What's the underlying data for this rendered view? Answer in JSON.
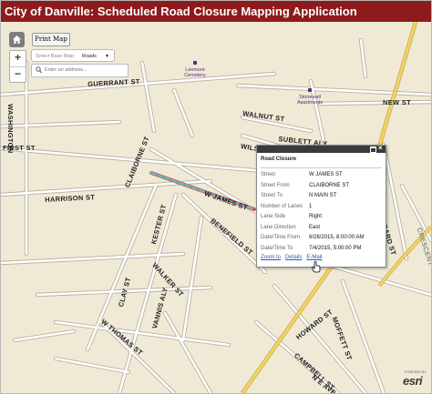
{
  "app": {
    "title": "City of Danville: Scheduled Road Closure Mapping Application"
  },
  "toolbar": {
    "print_label": "Print Map",
    "basemap_label": "Select Base Map:",
    "basemap_value": "Roads",
    "search_placeholder": "Enter an address..."
  },
  "map": {
    "streets": {
      "washington": "WASHINGTON",
      "guerrant": "GUERRANT ST",
      "new": "NEW ST",
      "walnut": "WALNUT ST",
      "sublett": "SUBLETT ALY",
      "wilson": "WILSON",
      "first": "FIRST ST",
      "claiborne": "CLAIBORNE ST",
      "wjames": "W JAMES ST",
      "harrison": "HARRISON ST",
      "kester": "KESTER ST",
      "benefield": "BENEFIELD ST",
      "girard": "GIRARD ST",
      "crescent": "CRESCENT",
      "walker": "WALKER ST",
      "clay": "CLAY ST",
      "wthomas": "W THOMAS ST",
      "vannis": "VANNIS ALY",
      "moffett": "MOFFETT ST",
      "howard": "HOWARD ST",
      "campbell": "CAMPBELL ST",
      "neave": "N E AVE"
    },
    "poi": {
      "cemetery": "Leemont Cemetery",
      "apartments": "Stonewall Apartments"
    }
  },
  "popup": {
    "title": "Road Closure",
    "fields": [
      {
        "key": "Street",
        "value": "W JAMES ST"
      },
      {
        "key": "Street From",
        "value": "CLAIBORNE ST"
      },
      {
        "key": "Street To",
        "value": "N MAIN ST"
      },
      {
        "key": "Number of Lanes",
        "value": "1"
      },
      {
        "key": "Lane Side",
        "value": "Right"
      },
      {
        "key": "Lane Direction",
        "value": "East"
      },
      {
        "key": "Date/Time From",
        "value": "6/28/2015, 8:00:00 AM"
      },
      {
        "key": "Date/Time To",
        "value": "7/4/2015, 5:00:00 PM"
      }
    ],
    "links": {
      "zoom": "Zoom to",
      "details": "Details",
      "email": "E-Mail"
    }
  },
  "attribution": {
    "powered": "POWERED BY",
    "brand": "esri"
  },
  "colors": {
    "title_bar": "#8e1b1c",
    "map_bg": "#efe9d6",
    "highway": "#f1d466",
    "closure": "#5ac1c4"
  },
  "icons": {
    "home": "home-icon",
    "zoom_in": "zoom-in-icon",
    "zoom_out": "zoom-out-icon",
    "search": "search-icon",
    "close": "close-icon",
    "maximize": "maximize-icon",
    "cursor": "hand-cursor-icon"
  }
}
